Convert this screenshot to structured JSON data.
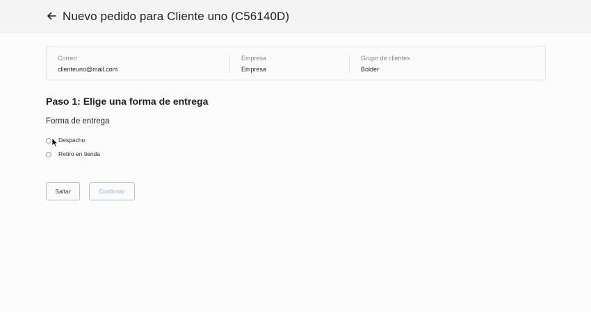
{
  "header": {
    "back_icon": "arrow-left-icon",
    "title": "Nuevo pedido para Cliente uno  (C56140D)"
  },
  "customer_info": {
    "email_label": "Correo",
    "email_value": "clienteuno@mail.com",
    "company_label": "Empresa",
    "company_value": "Empresa",
    "group_label": "Grupo de clientes",
    "group_value": "Bolder"
  },
  "step": {
    "title": "Paso 1: Elige una forma de entrega",
    "section_label": "Forma de entrega",
    "options": [
      {
        "label": "Despacho",
        "selected": false
      },
      {
        "label": "Retiro en tienda",
        "selected": false
      }
    ]
  },
  "actions": {
    "skip_label": "Saltar",
    "confirm_label": "Confirmar"
  },
  "colors": {
    "background": "#fbfbfb",
    "header_background": "#f4f4f4",
    "confirm_border": "#a9c4e4",
    "confirm_text": "#9ab6d8"
  }
}
